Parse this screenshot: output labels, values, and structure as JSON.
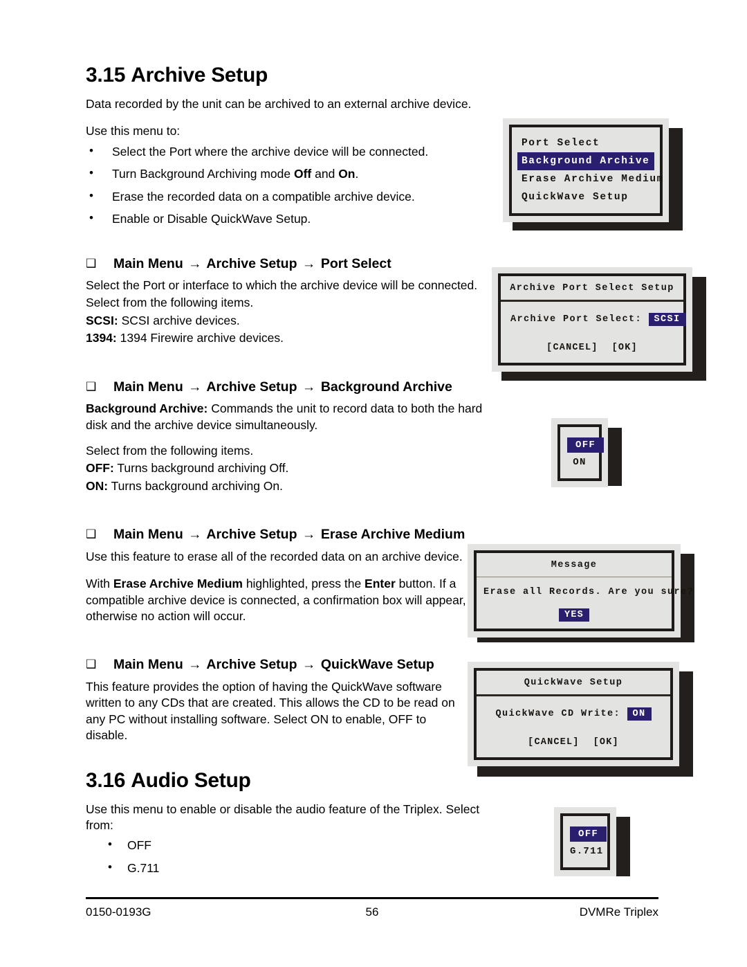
{
  "document": {
    "sections": [
      {
        "number": "3.15",
        "title": "Archive Setup",
        "intro": "Data recorded by the unit can be archived to an external archive device.",
        "lead": "Use this menu to:",
        "bullets": [
          "Select the Port where the archive device will be connected.",
          "Turn Background Archiving mode Off and On.",
          "Erase the recorded data on a compatible archive device.",
          "Enable or Disable QuickWave Setup."
        ]
      }
    ],
    "sub1": {
      "heading_prefix": "Main Menu",
      "heading_mid": "Archive Setup",
      "heading_suffix": "Port Select",
      "p1": "Select the Port or interface to which the archive device will be connected.",
      "p2": "Select from the following items.",
      "def1_term": "SCSI:",
      "def1_text": "SCSI archive devices.",
      "def2_term": "1394:",
      "def2_text": "1394 Firewire archive devices."
    },
    "sub2": {
      "heading_prefix": "Main Menu",
      "heading_mid": "Archive Setup",
      "heading_suffix": "Background Archive",
      "p1_term": "Background Archive:",
      "p1_text": "Commands the unit to record data to both the hard disk and the archive device simultaneously.",
      "p2": "Select from the following items.",
      "def1_term": "OFF:",
      "def1_text": "Turns background archiving Off.",
      "def2_term": "ON:",
      "def2_text": "Turns background archiving On."
    },
    "sub3": {
      "heading_prefix": "Main Menu",
      "heading_mid": "Archive Setup",
      "heading_suffix": "Erase Archive Medium",
      "p1": "Use this feature to erase all of the recorded data on an archive device.",
      "p2_a": "With ",
      "p2_b": "Erase Archive Medium",
      "p2_c": " highlighted, press the ",
      "p2_d": "Enter",
      "p2_e": " button.  If a compatible archive device is connected, a confirmation box will appear, otherwise no action will occur."
    },
    "sub4": {
      "heading_prefix": "Main Menu",
      "heading_mid": "Archive Setup",
      "heading_suffix": "QuickWave Setup",
      "p1": "This feature provides the option of having the QuickWave software written to any CDs that are created. This allows the CD to be read on any PC without installing software. Select ON to enable, OFF to disable."
    },
    "section2": {
      "number": "3.16",
      "title": "Audio Setup",
      "intro": "Use this menu to enable or disable the audio feature of the Triplex. Select from:",
      "bullets": [
        "OFF",
        "G.711"
      ]
    },
    "arrow_glyph": "→",
    "checkbox_glyph": "❑"
  },
  "osd": {
    "archive_menu": {
      "items": [
        "Port Select",
        "Background Archive",
        "Erase Archive Medium",
        "QuickWave Setup"
      ],
      "selected_index": 1
    },
    "port_select_dialog": {
      "title": "Archive Port Select Setup",
      "field_label": "Archive Port Select:",
      "field_value": "SCSI",
      "cancel": "[CANCEL]",
      "ok": "[OK]"
    },
    "background_archive_box": {
      "options": [
        "OFF",
        "ON"
      ],
      "selected_index": 0
    },
    "message_dialog": {
      "title": "Message",
      "text": "Erase all Records. Are you sure?",
      "confirm": "YES"
    },
    "quickwave_dialog": {
      "title": "QuickWave Setup",
      "field_label": "QuickWave CD Write:",
      "field_value": "ON",
      "cancel": "[CANCEL]",
      "ok": "[OK]"
    },
    "audio_box": {
      "options": [
        "OFF",
        "G.711"
      ],
      "selected_index": 0
    },
    "highlight_color": "#2a1f6e",
    "panel_color": "#e3e3e1",
    "border_color": "#1d1a17"
  },
  "footer": {
    "left": "0150-0193G",
    "center": "56",
    "right": "DVMRe Triplex"
  }
}
